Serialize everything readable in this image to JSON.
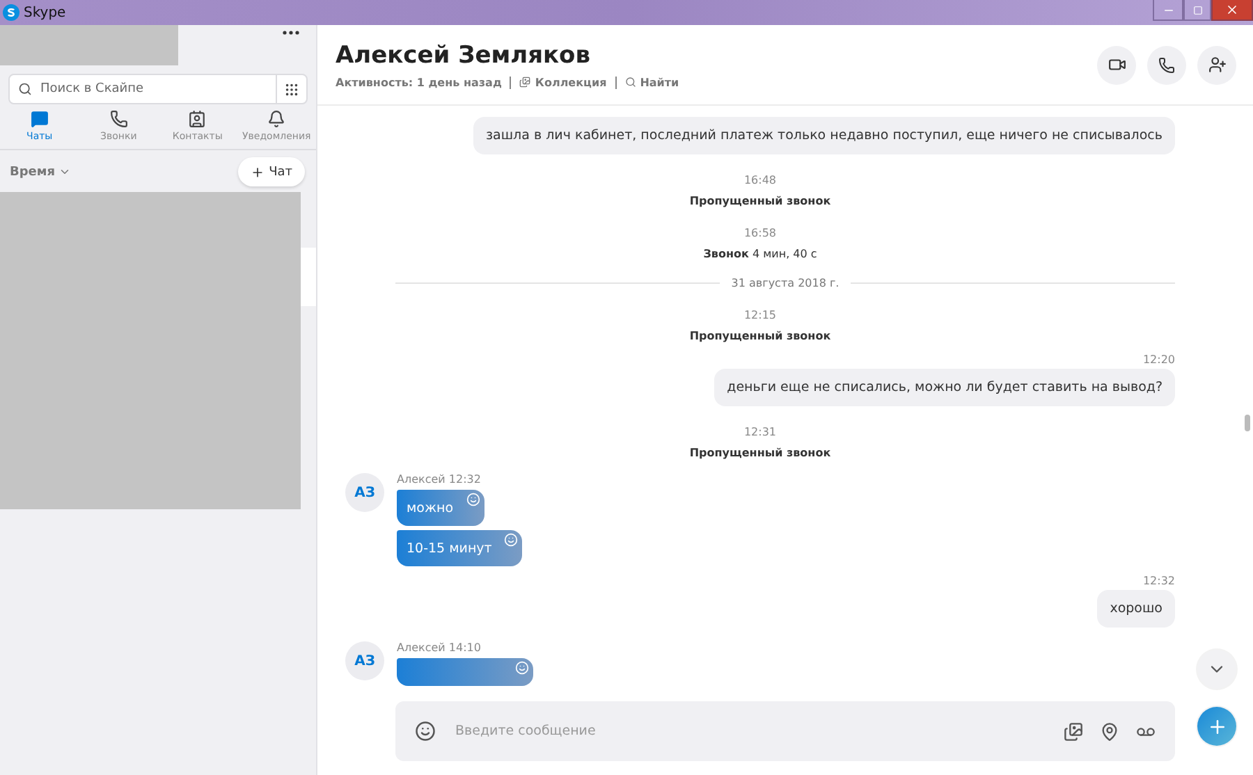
{
  "window": {
    "title": "Skype"
  },
  "sidebar": {
    "search": {
      "placeholder": "Поиск в Скайпе"
    },
    "tabs": [
      {
        "label": "Чаты",
        "selected": true
      },
      {
        "label": "Звонки",
        "selected": false
      },
      {
        "label": "Контакты",
        "selected": false
      },
      {
        "label": "Уведомления",
        "selected": false
      }
    ],
    "sort": "Время",
    "new_chat": "Чат"
  },
  "chat": {
    "name": "Алексей Земляков",
    "activity": "Активность: 1 день назад",
    "links": [
      "Коллекция",
      "Найти"
    ],
    "messages": [
      {
        "kind": "outgoing",
        "text": "зашла в лич кабинет, последний платеж только недавно поступил, еще ничего не списывалось"
      },
      {
        "kind": "event",
        "time": "16:48",
        "text": "**Пропущенный звонок**"
      },
      {
        "kind": "event",
        "time": "16:58",
        "text": "**Звонок** 4 мин, 40 с"
      },
      {
        "kind": "date",
        "text": "31 августа 2018 г."
      },
      {
        "kind": "event",
        "time": "12:15",
        "text": "**Пропущенный звонок**"
      },
      {
        "kind": "outgoing",
        "time": "12:20",
        "text": "деньги еще  не списались, можно ли будет ставить на вывод?"
      },
      {
        "kind": "event",
        "time": "12:31",
        "text": "**Пропущенный звонок**"
      },
      {
        "kind": "incoming",
        "avatar": "АЗ",
        "header": "Алексей 12:32",
        "bubbles": [
          "можно",
          "10-15 минут"
        ]
      },
      {
        "kind": "outgoing",
        "time": "12:32",
        "text": "хорошо"
      },
      {
        "kind": "incoming",
        "avatar": "АЗ",
        "header": "Алексей 14:10",
        "cut_off": true
      }
    ],
    "composer": {
      "placeholder": "Введите сообщение"
    }
  }
}
